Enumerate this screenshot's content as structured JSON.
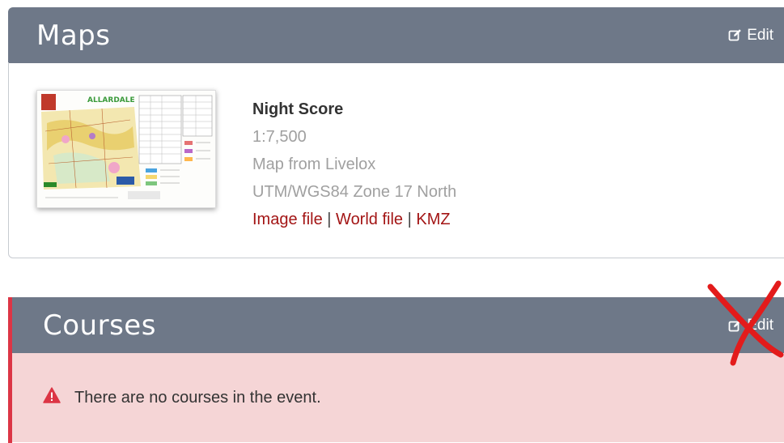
{
  "maps": {
    "title": "Maps",
    "edit_label": "Edit",
    "map": {
      "thumbnail_text": "ALLARDALE",
      "name": "Night Score",
      "scale": "1:7,500",
      "source": "Map from Livelox",
      "projection": "UTM/WGS84 Zone 17 North",
      "links": [
        "Image file",
        "World file",
        "KMZ"
      ],
      "separator": "|"
    }
  },
  "courses": {
    "title": "Courses",
    "edit_label": "Edit",
    "alert_text": "There are no courses in the event."
  },
  "colors": {
    "header_bg": "#6e7888",
    "link": "#a31515",
    "danger": "#dc3545",
    "alert_bg": "#f5d5d6",
    "annotation": "#e31b1b"
  }
}
